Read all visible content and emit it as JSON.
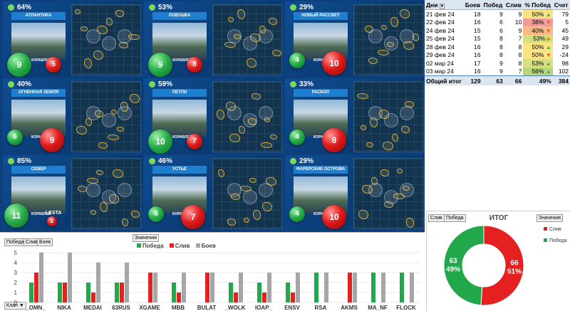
{
  "tiles": [
    {
      "pct": "64%",
      "name": "АТЛАНТИКА",
      "wins": "9",
      "losses": "5"
    },
    {
      "pct": "53%",
      "name": "ЛОВУШКА",
      "wins": "9",
      "losses": "8"
    },
    {
      "pct": "29%",
      "name": "НОВЫЙ РАССВЕТ",
      "wins": "4",
      "losses": "10"
    },
    {
      "pct": "40%",
      "name": "ОГНЕННАЯ ЗЕМЛЯ",
      "wins": "6",
      "losses": "9"
    },
    {
      "pct": "59%",
      "name": "ПЕТЛИ",
      "wins": "10",
      "losses": "7"
    },
    {
      "pct": "33%",
      "name": "РАСКОЛ",
      "wins": "4",
      "losses": "8"
    },
    {
      "pct": "85%",
      "name": "СЕВЕР",
      "wins": "11",
      "losses": "2"
    },
    {
      "pct": "46%",
      "name": "УСТЬЕ",
      "wins": "6",
      "losses": "7"
    },
    {
      "pct": "29%",
      "name": "ФАРЕРСКИЕ ОСТРОВА",
      "wins": "4",
      "losses": "10"
    }
  ],
  "tile_caption": "КОРАБЛЕЙ",
  "north_logo": "LESTA",
  "table": {
    "headers": [
      "Дни",
      "Боев",
      "Побед",
      "Слив",
      "% Побед",
      "Счет"
    ],
    "rows": [
      {
        "day": "21 фев 24",
        "battles": "18",
        "wins": "9",
        "losses": "9",
        "pct": "50%",
        "trend": "up",
        "score": "79",
        "color": "#f8e483"
      },
      {
        "day": "22 фев 24",
        "battles": "16",
        "wins": "6",
        "losses": "10",
        "pct": "38%",
        "trend": "down",
        "score": "5",
        "color": "#f29b9b"
      },
      {
        "day": "24 фев 24",
        "battles": "15",
        "wins": "6",
        "losses": "9",
        "pct": "40%",
        "trend": "down",
        "score": "45",
        "color": "#f8b984"
      },
      {
        "day": "25 фев 24",
        "battles": "15",
        "wins": "8",
        "losses": "7",
        "pct": "53%",
        "trend": "right",
        "score": "49",
        "color": "#d4e07f"
      },
      {
        "day": "28 фев 24",
        "battles": "16",
        "wins": "8",
        "losses": "8",
        "pct": "50%",
        "trend": "up",
        "score": "29",
        "color": "#f8e483"
      },
      {
        "day": "29 фев 24",
        "battles": "16",
        "wins": "8",
        "losses": "8",
        "pct": "50%",
        "trend": "down",
        "score": "-24",
        "color": "#f8e483"
      },
      {
        "day": "02 мар 24",
        "battles": "17",
        "wins": "9",
        "losses": "8",
        "pct": "53%",
        "trend": "up",
        "score": "98",
        "color": "#d4e07f"
      },
      {
        "day": "03 мар 24",
        "battles": "16",
        "wins": "9",
        "losses": "7",
        "pct": "56%",
        "trend": "up",
        "score": "102",
        "color": "#b5d67d"
      }
    ],
    "total": {
      "label": "Общий итог",
      "battles": "129",
      "wins": "63",
      "losses": "66",
      "pct": "49%",
      "score": "384"
    }
  },
  "chart_data": [
    {
      "type": "bar",
      "categories": [
        "_OMN_",
        "NIKA",
        "MEDAI",
        "63RUS",
        "XGAME",
        "MBB",
        "BULAT",
        "_WOLK",
        "IOAP_",
        "ENSV",
        "RSA",
        "AKMS",
        "MA_NF",
        "FLOCK"
      ],
      "series": [
        {
          "name": "Победа",
          "values": [
            2,
            2,
            2,
            2,
            0,
            2,
            0,
            2,
            2,
            2,
            3,
            0,
            3,
            3
          ],
          "color": "#22a84a"
        },
        {
          "name": "Слив",
          "values": [
            3,
            2,
            1,
            2,
            3,
            1,
            3,
            1,
            1,
            1,
            0,
            3,
            0,
            0
          ],
          "color": "#e52020"
        },
        {
          "name": "Боев",
          "values": [
            5,
            5,
            4,
            4,
            3,
            3,
            3,
            3,
            3,
            3,
            3,
            3,
            3,
            3
          ],
          "color": "#a6a6a6"
        }
      ],
      "yticks": [
        "0",
        "1",
        "2",
        "3",
        "4",
        "5"
      ],
      "ylim": [
        0,
        5
      ],
      "legend": "top"
    },
    {
      "type": "pie",
      "title": "ИТОГ",
      "slices": [
        {
          "name": "Слив",
          "value": 66,
          "pct": "51%",
          "color": "#e52020"
        },
        {
          "name": "Победа",
          "value": 63,
          "pct": "49%",
          "color": "#22a84a"
        }
      ],
      "legend": "right"
    }
  ],
  "bottom_buttons": {
    "filter1": "Победа",
    "filter2": "Слив",
    "filter3": "Боев",
    "values": "Значения",
    "clan": "Клан"
  },
  "pie_buttons": {
    "b1": "Слив",
    "b2": "Победа",
    "values": "Значения"
  }
}
